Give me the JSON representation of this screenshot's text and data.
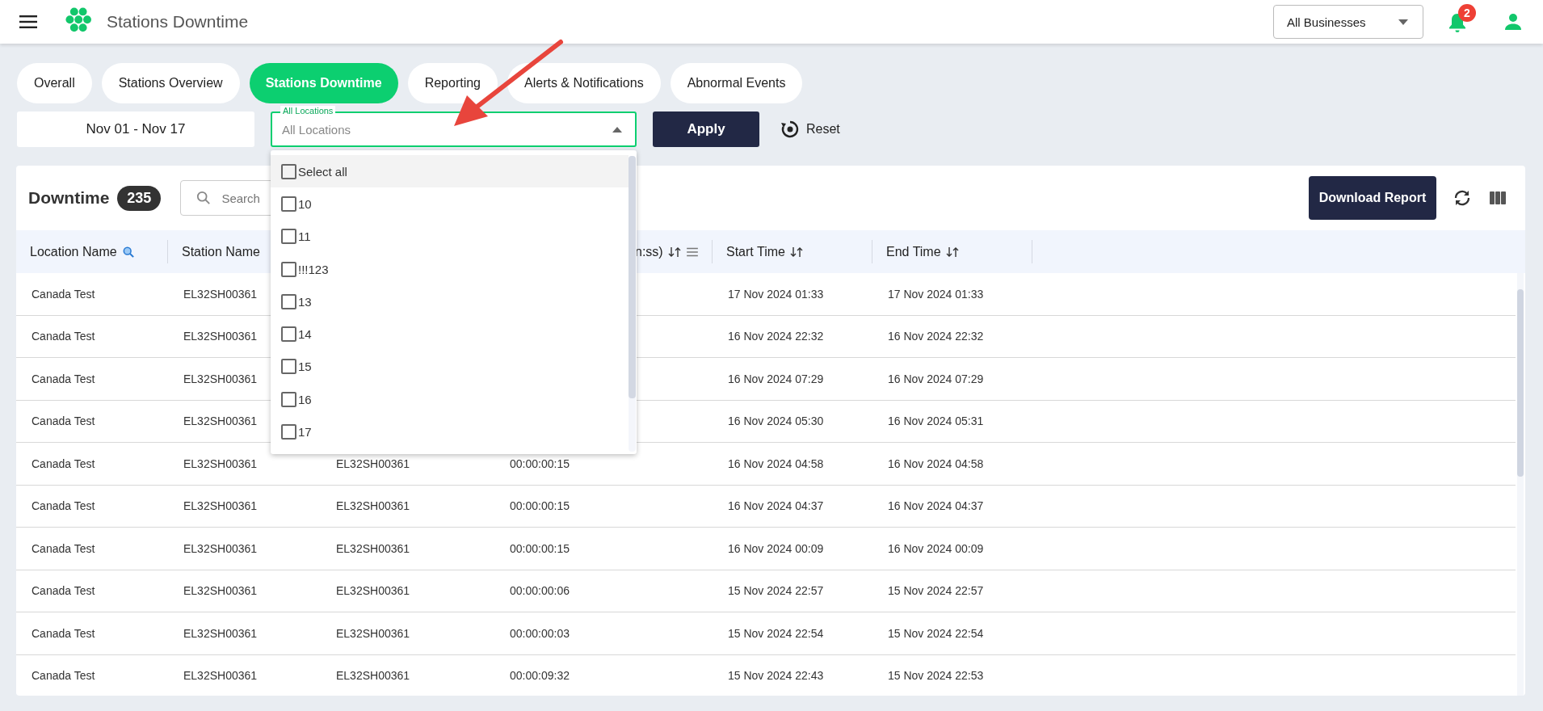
{
  "topbar": {
    "title": "Stations Downtime",
    "business_select": {
      "value": "All Businesses"
    },
    "notifications": {
      "count": "2"
    }
  },
  "tabs": [
    {
      "label": "Overall",
      "selected": false
    },
    {
      "label": "Stations Overview",
      "selected": false
    },
    {
      "label": "Stations Downtime",
      "selected": true
    },
    {
      "label": "Reporting",
      "selected": false
    },
    {
      "label": "Alerts & Notifications",
      "selected": false
    },
    {
      "label": "Abnormal Events",
      "selected": false
    }
  ],
  "filters": {
    "date_range": "Nov 01 - Nov 17",
    "location_select": {
      "label": "All Locations",
      "placeholder": "All Locations",
      "expanded": true
    },
    "apply": "Apply",
    "reset": "Reset"
  },
  "location_options": [
    {
      "label": "Select all",
      "checked": false,
      "highlighted": true
    },
    {
      "label": "10",
      "checked": false,
      "highlighted": false
    },
    {
      "label": "11",
      "checked": false,
      "highlighted": false
    },
    {
      "label": "!!!123",
      "checked": false,
      "highlighted": false
    },
    {
      "label": "13",
      "checked": false,
      "highlighted": false
    },
    {
      "label": "14",
      "checked": false,
      "highlighted": false
    },
    {
      "label": "15",
      "checked": false,
      "highlighted": false
    },
    {
      "label": "16",
      "checked": false,
      "highlighted": false
    },
    {
      "label": "17",
      "checked": false,
      "highlighted": false
    }
  ],
  "card": {
    "title": "Downtime",
    "count": "235",
    "search": {
      "placeholder": "Search"
    },
    "download": "Download Report"
  },
  "header": {
    "location_name": {
      "label": "Location Name",
      "filter_icon": true
    },
    "station_name": {
      "label": "Station Name"
    },
    "column_4": {
      "label": "n:ss)",
      "sortable": true,
      "menu": true
    },
    "start_time": {
      "label": "Start Time",
      "sortable": true
    },
    "end_time": {
      "label": "End Time",
      "sortable": true
    }
  },
  "rows": [
    {
      "location_name": "Canada Test",
      "station_name": "EL32SH00361",
      "start_time": "17 Nov 2024 01:33",
      "end_time": "17 Nov 2024 01:33"
    },
    {
      "location_name": "Canada Test",
      "station_name": "EL32SH00361",
      "start_time": "16 Nov 2024 22:32",
      "end_time": "16 Nov 2024 22:32"
    },
    {
      "location_name": "Canada Test",
      "station_name": "EL32SH00361",
      "start_time": "16 Nov 2024 07:29",
      "end_time": "16 Nov 2024 07:29"
    },
    {
      "location_name": "Canada Test",
      "station_name": "EL32SH00361",
      "start_time": "16 Nov 2024 05:30",
      "end_time": "16 Nov 2024 05:31"
    },
    {
      "location_name": "Canada Test",
      "station_name": "EL32SH00361",
      "column_3": "EL32SH00361",
      "column_4": "00:00:00:15",
      "start_time": "16 Nov 2024 04:58",
      "end_time": "16 Nov 2024 04:58"
    },
    {
      "location_name": "Canada Test",
      "station_name": "EL32SH00361",
      "column_3": "EL32SH00361",
      "column_4": "00:00:00:15",
      "start_time": "16 Nov 2024 04:37",
      "end_time": "16 Nov 2024 04:37"
    },
    {
      "location_name": "Canada Test",
      "station_name": "EL32SH00361",
      "column_3": "EL32SH00361",
      "column_4": "00:00:00:15",
      "start_time": "16 Nov 2024 00:09",
      "end_time": "16 Nov 2024 00:09"
    },
    {
      "location_name": "Canada Test",
      "station_name": "EL32SH00361",
      "column_3": "EL32SH00361",
      "column_4": "00:00:00:06",
      "start_time": "15 Nov 2024 22:57",
      "end_time": "15 Nov 2024 22:57"
    },
    {
      "location_name": "Canada Test",
      "station_name": "EL32SH00361",
      "column_3": "EL32SH00361",
      "column_4": "00:00:00:03",
      "start_time": "15 Nov 2024 22:54",
      "end_time": "15 Nov 2024 22:54"
    },
    {
      "location_name": "Canada Test",
      "station_name": "EL32SH00361",
      "column_3": "EL32SH00361",
      "column_4": "00:00:09:32",
      "start_time": "15 Nov 2024 22:43",
      "end_time": "15 Nov 2024 22:53"
    }
  ]
}
